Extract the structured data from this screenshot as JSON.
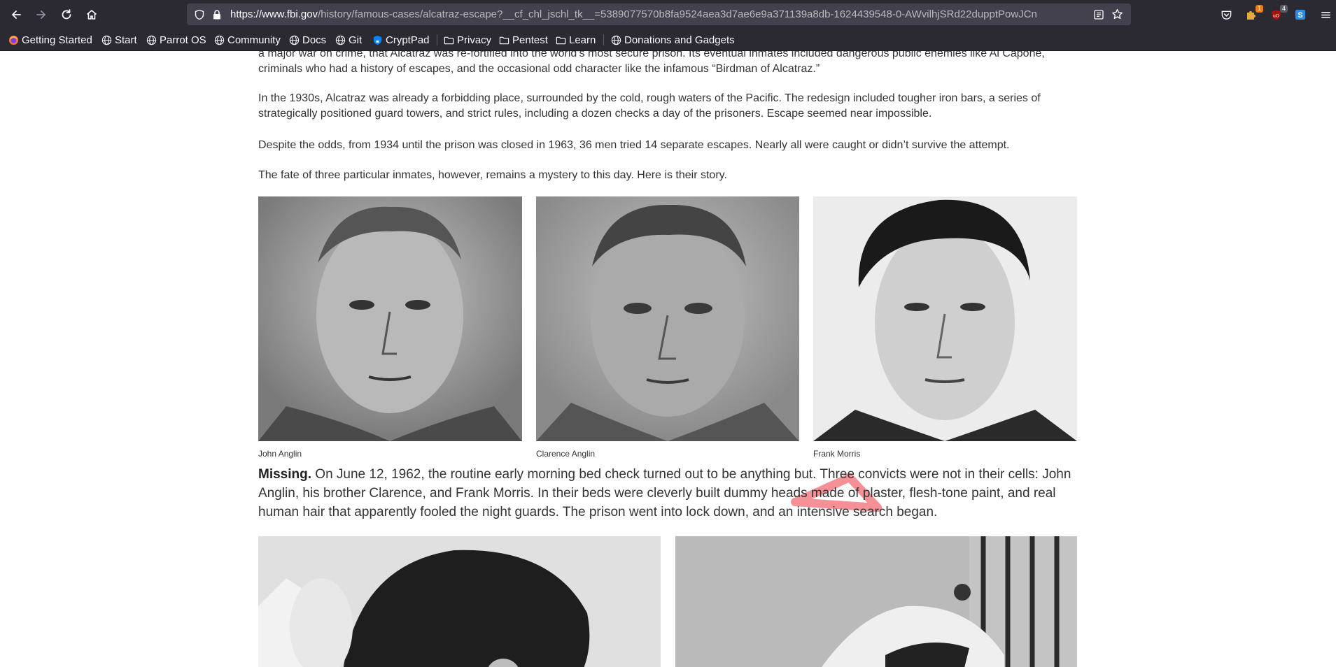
{
  "browser": {
    "url_host": "https://www.fbi.gov",
    "url_path": "/history/famous-cases/alcatraz-escape?__cf_chl_jschl_tk__=5389077570b8fa9524aea3d7ae6e9a371139a8db-1624439548-0-AWvilhjSRd22dupptPowJCn",
    "extension_badge_1": "1",
    "extension_badge_2": "4"
  },
  "bookmarks": [
    {
      "label": "Getting Started",
      "icon": "firefox-icon"
    },
    {
      "label": "Start",
      "icon": "globe-icon"
    },
    {
      "label": "Parrot OS",
      "icon": "globe-icon"
    },
    {
      "label": "Community",
      "icon": "globe-icon"
    },
    {
      "label": "Docs",
      "icon": "globe-icon"
    },
    {
      "label": "Git",
      "icon": "globe-icon"
    },
    {
      "label": "CryptPad",
      "icon": "cryptpad-icon"
    },
    {
      "label": "Privacy",
      "icon": "folder-icon"
    },
    {
      "label": "Pentest",
      "icon": "folder-icon"
    },
    {
      "label": "Learn",
      "icon": "folder-icon"
    },
    {
      "label": "Donations and Gadgets",
      "icon": "globe-icon"
    }
  ],
  "article": {
    "para_top": "a major war on crime, that Alcatraz was re-fortified into the world’s most secure prison. Its eventual inmates included dangerous public enemies like Al Capone, criminals who had a history of escapes, and the occasional odd character like the infamous “Birdman of Alcatraz.”",
    "para_1930s": "In the 1930s, Alcatraz was already a forbidding place, surrounded by the cold, rough waters of the Pacific. The redesign included tougher iron bars, a series of strategically positioned guard towers, and strict rules, including a dozen checks a day of the prisoners. Escape seemed near impossible.",
    "para_odds": "Despite the odds, from 1934 until the prison was closed in 1963, 36 men tried 14 separate escapes. Nearly all were caught or didn’t survive the attempt.",
    "para_fate": "The fate of three particular inmates, however, remains a mystery to this day. Here is their story.",
    "captions": [
      "John Anglin",
      "Clarence Anglin",
      "Frank Morris"
    ],
    "missing_lead": "Missing.",
    "missing_text": " On June 12, 1962, the routine early morning bed check turned out to be anything but. Three convicts were not in their cells: John Anglin, his brother Clarence, and Frank Morris. In their beds were cleverly built dummy heads made of plaster, flesh-tone paint, and real human hair that apparently fooled the night guards. The prison went into lock down, and an intensive search began."
  },
  "colors": {
    "chrome": "#2b2a33",
    "urlbar": "#42414d",
    "annotation": "#f27d84"
  }
}
